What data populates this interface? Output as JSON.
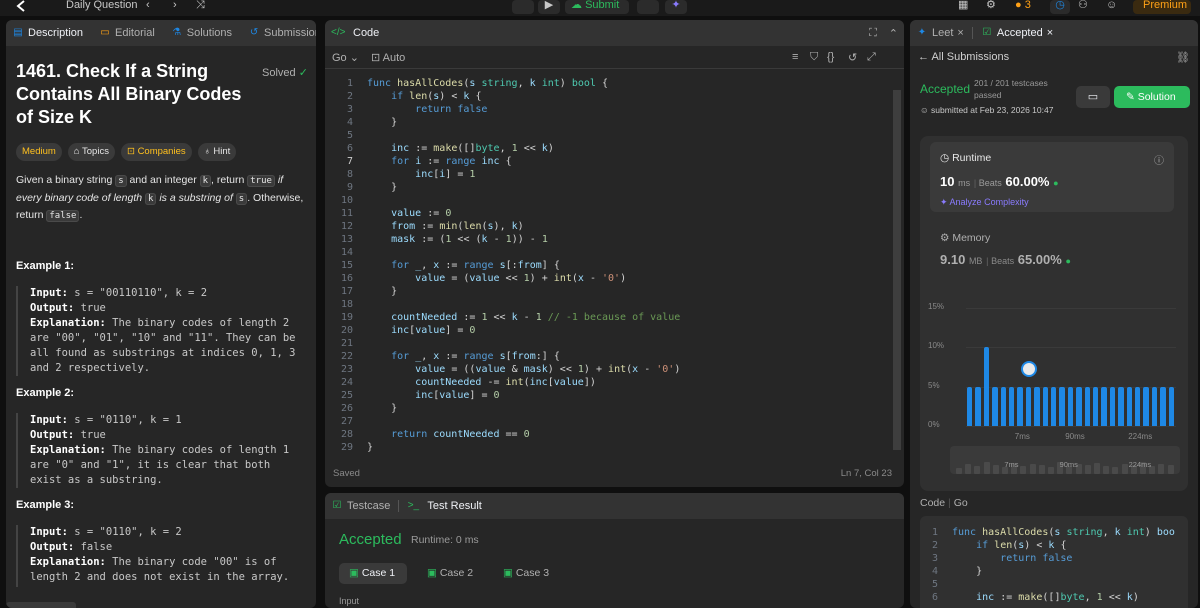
{
  "topbar": {
    "daily": "Daily Question",
    "submit": "Submit",
    "streak": "3",
    "premium": "Premium"
  },
  "colors": {
    "accent_green": "#2cbb5d",
    "easy": "#00b8a3",
    "medium": "#ffc01e",
    "blue": "#1e88e5"
  },
  "description": {
    "tabs": [
      "Description",
      "Editorial",
      "Solutions",
      "Submissions"
    ],
    "title": "1461. Check If a String Contains All Binary Codes of Size K",
    "solved": "Solved",
    "tags": [
      "Medium",
      "Topics",
      "Companies",
      "Hint"
    ],
    "p1": "Given a binary string ",
    "p_s": "s",
    "p2": " and an integer ",
    "p_k": "k",
    "p3": ", return ",
    "p_true": "true",
    "p4": " if every binary code of length ",
    "p_k2": "k",
    "p5": " is a substring of ",
    "p_s2": "s",
    "p6": ". Otherwise, return ",
    "p_false": "false",
    "p7": ".",
    "examples": [
      {
        "heading": "Example 1:",
        "input_label": "Input:",
        "input": " s = \"00110110\", k = 2",
        "output_label": "Output:",
        "output": " true",
        "explanation_label": "Explanation:",
        "explanation": " The binary codes of length 2 are \"00\", \"01\", \"10\" and \"11\". They can be all found as substrings at indices 0, 1, 3 and 2 respectively."
      },
      {
        "heading": "Example 2:",
        "input_label": "Input:",
        "input": " s = \"0110\", k = 1",
        "output_label": "Output:",
        "output": " true",
        "explanation_label": "Explanation:",
        "explanation": " The binary codes of length 1 are \"0\" and \"1\", it is clear that both exist as a substring."
      },
      {
        "heading": "Example 3:",
        "input_label": "Input:",
        "input": " s = \"0110\", k = 2",
        "output_label": "Output:",
        "output": " false",
        "explanation_label": "Explanation:",
        "explanation": " The binary code \"00\" is of length 2 and does not exist in the array."
      }
    ]
  },
  "editor": {
    "tab": "Code",
    "language": "Go",
    "mode": "Auto",
    "saved": "Saved",
    "cursor": "Ln 7, Col 23",
    "lines": [
      "func hasAllCodes(s string, k int) bool {",
      "    if len(s) < k {",
      "        return false",
      "    }",
      "",
      "    inc := make([]byte, 1 << k)",
      "    for i := range inc {",
      "        inc[i] = 1",
      "    }",
      "",
      "    value := 0",
      "    from := min(len(s), k)",
      "    mask := (1 << (k - 1)) - 1",
      "",
      "    for _, x := range s[:from] {",
      "        value = (value << 1) + int(x - '0')",
      "    }",
      "",
      "    countNeeded := 1 << k - 1 // -1 because of value",
      "    inc[value] = 0",
      "",
      "    for _, x := range s[from:] {",
      "        value = ((value & mask) << 1) + int(x - '0')",
      "        countNeeded -= int(inc[value])",
      "        inc[value] = 0",
      "    }",
      "",
      "    return countNeeded == 0",
      "}"
    ]
  },
  "testpanel": {
    "tabs": [
      "Testcase",
      "Test Result"
    ],
    "status": "Accepted",
    "runtime": "Runtime: 0 ms",
    "cases": [
      "Case 1",
      "Case 2",
      "Case 3"
    ],
    "input_label": "Input"
  },
  "submission": {
    "tabs": [
      "Leet",
      "Accepted"
    ],
    "back": "All Submissions",
    "status": "Accepted",
    "passed": "201 / 201 testcases passed",
    "submitted": "submitted at Feb 23, 2026 10:47",
    "solution_btn": "Solution",
    "runtime": {
      "label": "Runtime",
      "value": "10",
      "unit": "ms",
      "beats_label": "Beats",
      "beats": "60.00%",
      "analyze": "Analyze Complexity"
    },
    "memory": {
      "label": "Memory",
      "value": "9.10",
      "unit": "MB",
      "beats_label": "Beats",
      "beats": "65.00%"
    },
    "code_label": "Code",
    "code_lang": "Go",
    "code_lines": [
      "func hasAllCodes(s string, k int) boo",
      "    if len(s) < k {",
      "        return false",
      "    }",
      "",
      "    inc := make([]byte, 1 << k)"
    ]
  },
  "chart_data": {
    "type": "bar",
    "ylim": [
      0,
      15
    ],
    "yticks": [
      "15%",
      "10%",
      "5%",
      "0%"
    ],
    "xticks": [
      "7ms",
      "90ms",
      "224ms"
    ],
    "values": [
      5,
      5,
      10,
      5,
      5,
      5,
      5,
      5,
      5,
      5,
      5,
      5,
      5,
      5,
      5,
      5,
      5,
      5,
      5,
      5,
      5,
      5,
      5,
      5,
      5
    ],
    "highlight_index": 7,
    "overview_ticks": [
      "7ms",
      "90ms",
      "224ms"
    ]
  }
}
